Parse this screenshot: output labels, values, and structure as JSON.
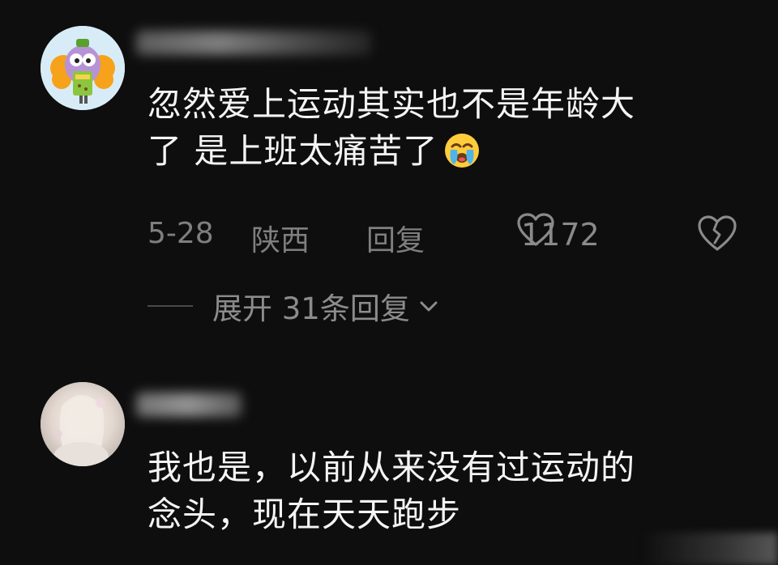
{
  "comments": [
    {
      "text_line1": "忽然爱上运动其实也不是年龄大",
      "text_line2": "了  是上班太痛苦了",
      "emoji": "crying-face-emoji",
      "date": "5-28",
      "location": "陕西",
      "reply_label": "回复",
      "like_count": "1172",
      "expand_label": "展开 31条回复"
    },
    {
      "text_line1": "我也是，以前从来没有过运动的",
      "text_line2": "念头，现在天天跑步"
    }
  ],
  "colors": {
    "background": "#0e0e0f",
    "text": "#f4f4f4",
    "meta": "#7f7f7f"
  },
  "icons": {
    "like": "heart-outline-icon",
    "dislike": "broken-heart-icon",
    "expand": "chevron-down-icon"
  }
}
